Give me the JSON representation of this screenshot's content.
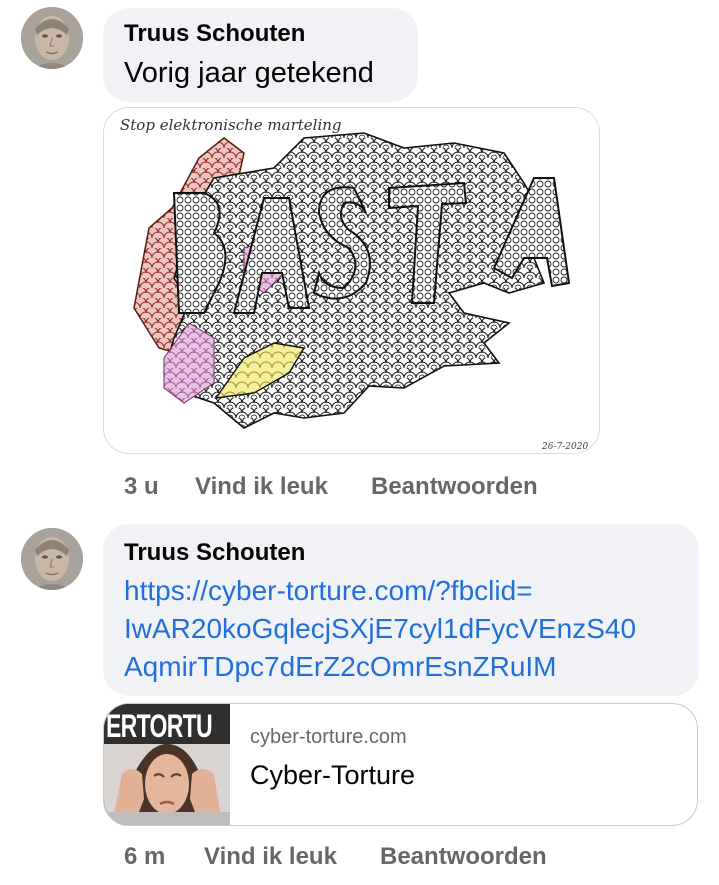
{
  "comments": [
    {
      "author": "Truus Schouten",
      "text": "Vorig jaar getekend",
      "image": {
        "caption": "Stop elektronische marteling",
        "word": "BASTA",
        "date": "26-7-2020"
      },
      "time": "3 u",
      "like_label": "Vind ik leuk",
      "reply_label": "Beantwoorden"
    },
    {
      "author": "Truus Schouten",
      "link_lines": [
        "https://cyber-torture.com/?fbclid=",
        "IwAR20koGqlecjSXjE7cyl1dFycVEnzS40",
        "AqmirTDpc7dErZ2cOmrEsnZRuIM"
      ],
      "preview": {
        "thumb_text": "ERTORTU",
        "domain": "cyber-torture.com",
        "title": "Cyber-Torture"
      },
      "time": "6 m",
      "like_label": "Vind ik leuk",
      "reply_label": "Beantwoorden"
    }
  ],
  "icons": {
    "avatar": "profile-photo"
  },
  "colors": {
    "bubble": "#f0f2f5",
    "link": "#216fdb",
    "meta": "#65676b"
  }
}
